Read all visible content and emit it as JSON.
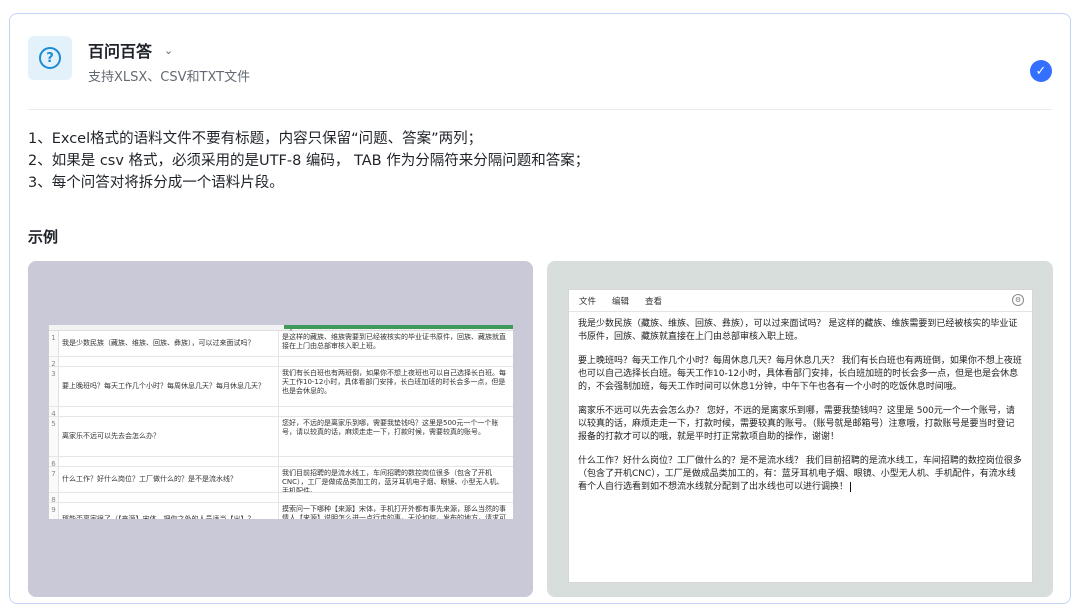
{
  "header": {
    "title": "百问百答",
    "subtitle": "支持XLSX、CSV和TXT文件",
    "icon": "qa-icon",
    "selected": true,
    "accent_color": "#3370ff"
  },
  "rules": [
    "1、Excel格式的语料文件不要有标题，内容只保留“问题、答案”两列；",
    "2、如果是 csv 格式，必须采用的是UTF-8 编码， TAB 作为分隔符来分隔问题和答案；",
    "3、每个问答对将拆分成一个语料片段。"
  ],
  "example_heading": "示例",
  "spreadsheet_example": {
    "rows": [
      {
        "num": "1",
        "q": "我是少数民族（藏族、维族、回族、彝族），可以过来面试吗？",
        "a": "是这样的藏族、维族需要到已经被核实的毕业证书原件，回族、藏族就直接在上门由总部审核入职上班。"
      },
      {
        "num": "2",
        "q": "",
        "a": ""
      },
      {
        "num": "3",
        "q": "要上晚班吗？每天工作几个小时？每周休息几天？每月休息几天？",
        "a": "我们有长白班也有两班倒，如果你不想上夜班也可以自己选择长白班。每天工作10-12小时，具体看部门安排，长白班加班的时长会多一点，但是也是会休息的。"
      },
      {
        "num": "4",
        "q": "",
        "a": ""
      },
      {
        "num": "5",
        "q": "离家乐不远可以先去会怎么办？",
        "a": "您好，不远的是离家乐到哪，需要我垫钱吗？这里是500元一个一个账号，请以较真的话，麻烦走走一下，打款时候，需要较真的账号。"
      },
      {
        "num": "6",
        "q": "",
        "a": ""
      },
      {
        "num": "7",
        "q": "什么工作？好什么岗位？工厂做什么的？是不是流水线？",
        "a": "我们目前招聘的是流水线工，车间招聘的数控岗位很多（包含了开机CNC），工厂是做成品类加工的，蓝牙耳机电子烟、眼镜、小型无人机、手机配件。"
      },
      {
        "num": "8",
        "q": "",
        "a": ""
      },
      {
        "num": "9",
        "q": "那能否离家很了（【来源】宋体，把你之外的人员适当【出】？",
        "a": "摸索问一下哪种【来源】宋体，手机打开外都有事先来源，那么当然的事情人【来源】说明怎么进一点行走的事，无论如何，发布的地方，请求可以正常的给些地点了解一下。"
      }
    ]
  },
  "text_example": {
    "menu": [
      "文件",
      "编辑",
      "查看"
    ],
    "paragraphs": [
      "我是少数民族（藏族、维族、回族、彝族），可以过来面试吗？    是这样的藏族、维族需要到已经被核实的毕业证书原件，回族、藏族就直接在上门由总部审核入职上班。",
      "要上晚班吗？每天工作几个小时？每周休息几天？每月休息几天？    我们有长白班也有两班倒，如果你不想上夜班也可以自己选择长白班。每天工作10-12小时，具体看部门安排，长白班加班的时长会多一点，但是也是会休息的，不会强制加班，每天工作时间可以休息1分钟，中午下午也各有一个小时的吃饭休息时间哦。",
      "离家乐不远可以先去会怎么办？    您好，不远的是离家乐到哪，需要我垫钱吗？这里是 500元一个一个账号，请以较真的话，麻烦走走一下，打款时候，需要较真的账号。（账号就是邮箱号）注意哦，打款账号是要当时登记报备的打款才可以的哦，就是平时打正常款项自助的操作，谢谢！",
      "什么工作？好什么岗位？工厂做什么的？是不是流水线？    我们目前招聘的是流水线工，车间招聘的数控岗位很多（包含了开机CNC），工厂是做成品类加工的，有：蓝牙耳机电子烟、眼镜、小型无人机、手机配件，有流水线看个人自行选看到如不想流水线就分配到了出水线也可以进行调换！"
    ]
  }
}
